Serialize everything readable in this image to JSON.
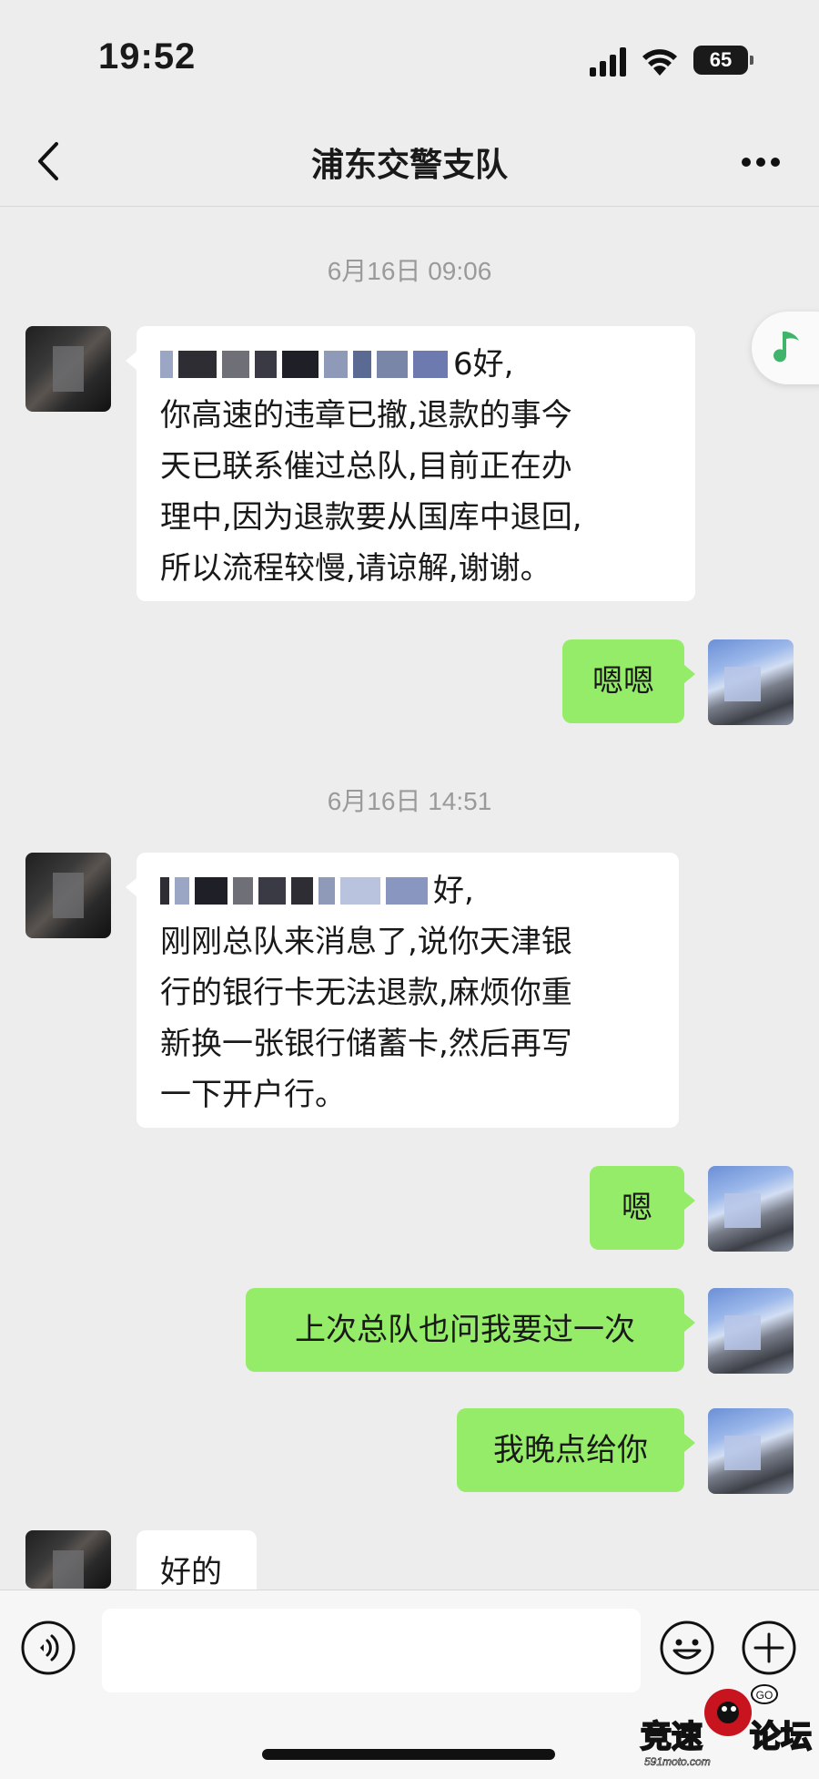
{
  "status_bar": {
    "time": "19:52",
    "battery": "65"
  },
  "header": {
    "title": "浦东交警支队"
  },
  "timestamps": [
    "6月16日 09:06",
    "6月16日 14:51"
  ],
  "messages": [
    {
      "side": "in",
      "lines": [
        "6好,",
        "你高速的违章已撤,退款的事今",
        "天已联系催过总队,目前正在办",
        "理中,因为退款要从国库中退回,",
        "所以流程较慢,请谅解,谢谢。"
      ]
    },
    {
      "side": "out",
      "text": "嗯嗯"
    },
    {
      "side": "in",
      "lines": [
        "好,",
        "刚刚总队来消息了,说你天津银",
        "行的银行卡无法退款,麻烦你重",
        "新换一张银行储蓄卡,然后再写",
        "一下开户行。"
      ]
    },
    {
      "side": "out",
      "text": "嗯"
    },
    {
      "side": "out",
      "text": "上次总队也问我要过一次"
    },
    {
      "side": "out",
      "text": "我晚点给你"
    },
    {
      "side": "in",
      "text": "好的"
    }
  ],
  "input_bar": {
    "placeholder": ""
  },
  "watermark": {
    "text_1": "竞速",
    "text_2": "论坛",
    "site": "591moto.com"
  },
  "colors": {
    "background": "#ededed",
    "incoming_bubble": "#ffffff",
    "outgoing_bubble": "#95ec69",
    "timestamp": "#9a9a9a"
  },
  "icons": [
    "back-icon",
    "more-icon",
    "music-note-icon",
    "voice-icon",
    "emoji-icon",
    "add-icon"
  ]
}
